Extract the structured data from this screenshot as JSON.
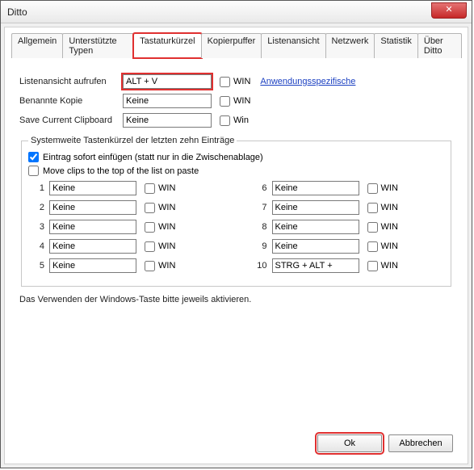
{
  "window": {
    "title": "Ditto"
  },
  "close": {
    "glyph": "✕"
  },
  "tabs": [
    {
      "label": "Allgemein",
      "active": false
    },
    {
      "label": "Unterstützte Typen",
      "active": false
    },
    {
      "label": "Tastaturkürzel",
      "active": true,
      "highlight": true
    },
    {
      "label": "Kopierpuffer",
      "active": false
    },
    {
      "label": "Listenansicht",
      "active": false
    },
    {
      "label": "Netzwerk",
      "active": false
    },
    {
      "label": "Statistik",
      "active": false
    },
    {
      "label": "Über Ditto",
      "active": false
    }
  ],
  "mainRows": [
    {
      "label": "Listenansicht aufrufen",
      "value": "ALT + V",
      "win_checked": false,
      "win_label": "WIN",
      "highlight": true
    },
    {
      "label": "Benannte Kopie",
      "value": "Keine",
      "win_checked": false,
      "win_label": "WIN"
    },
    {
      "label": "Save Current Clipboard",
      "value": "Keine",
      "win_checked": false,
      "win_label": "Win"
    }
  ],
  "link": {
    "label": "Anwendungsspezifische "
  },
  "group": {
    "legend": "Systemweite Tastenkürzel der letzten zehn Einträge",
    "check1": {
      "label": "Eintrag sofort einfügen (statt nur in die Zwischenablage)",
      "checked": true
    },
    "check2": {
      "label": "Move clips to the top of the list on paste",
      "checked": false
    },
    "win_label": "WIN",
    "left": [
      {
        "num": "1",
        "value": "Keine",
        "win_checked": false
      },
      {
        "num": "2",
        "value": "Keine",
        "win_checked": false
      },
      {
        "num": "3",
        "value": "Keine",
        "win_checked": false
      },
      {
        "num": "4",
        "value": "Keine",
        "win_checked": false
      },
      {
        "num": "5",
        "value": "Keine",
        "win_checked": false
      }
    ],
    "right": [
      {
        "num": "6",
        "value": "Keine",
        "win_checked": false
      },
      {
        "num": "7",
        "value": "Keine",
        "win_checked": false
      },
      {
        "num": "8",
        "value": "Keine",
        "win_checked": false
      },
      {
        "num": "9",
        "value": "Keine",
        "win_checked": false
      },
      {
        "num": "10",
        "value": "STRG + ALT + ",
        "win_checked": false
      }
    ]
  },
  "footer_note": "Das Verwenden der Windows-Taste bitte jeweils aktivieren.",
  "buttons": {
    "ok": "Ok",
    "cancel": "Abbrechen"
  }
}
